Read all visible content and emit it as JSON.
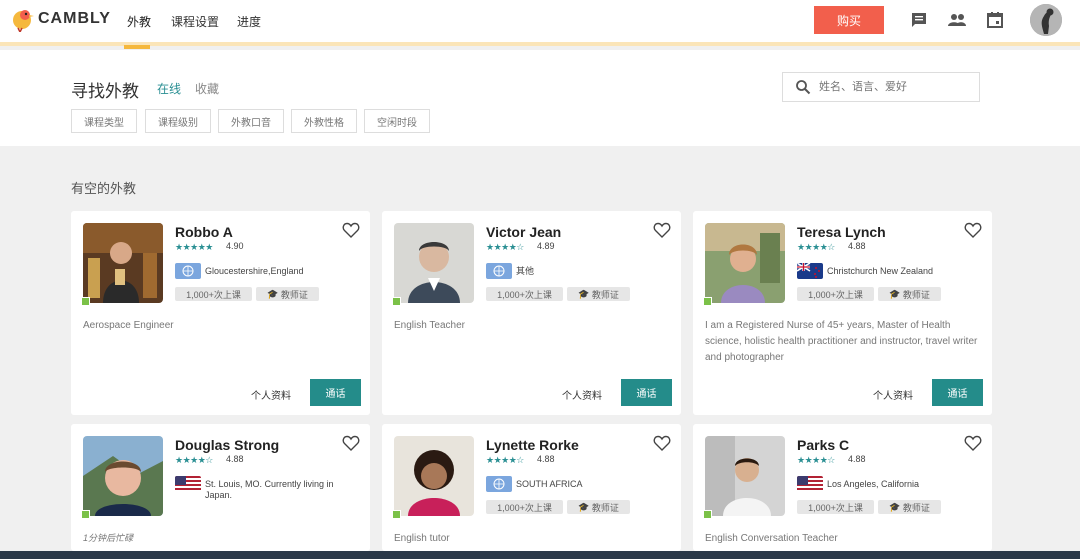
{
  "nav": {
    "brand": "CAMBLY",
    "links": [
      "外教",
      "课程设置",
      "进度"
    ],
    "buy_label": "购买"
  },
  "search": {
    "title": "寻找外教",
    "tab_online": "在线",
    "tab_favorites": "收藏",
    "placeholder": "姓名、语言、爱好",
    "filters": [
      "课程类型",
      "课程级别",
      "外教口音",
      "外教性格",
      "空闲时段"
    ]
  },
  "section_title": "有空的外教",
  "actions": {
    "profile": "个人资料",
    "call": "通话"
  },
  "badges": {
    "lessons": "1,000+次上课",
    "certified": "教师证"
  },
  "colors": {
    "accent": "#248c8a",
    "buy": "#f25f4c",
    "online": "#7bc148",
    "nav_underline": "#f5b83d"
  },
  "tutors": [
    {
      "name": "Robbo A",
      "stars": "★★★★★",
      "rating": "4.90",
      "flag": "un-flag",
      "location": "Gloucestershire,England",
      "bio": "Aerospace Engineer"
    },
    {
      "name": "Victor Jean",
      "stars": "★★★★☆",
      "rating": "4.89",
      "flag": "un-flag",
      "location": "其他",
      "bio": "English Teacher"
    },
    {
      "name": "Teresa Lynch",
      "stars": "★★★★☆",
      "rating": "4.88",
      "flag": "nz-flag",
      "location": "Christchurch New Zealand",
      "bio": "I am a Registered Nurse of 45+ years, Master of Health science, holistic health practitioner and instructor, travel writer and photographer"
    },
    {
      "name": "Douglas Strong",
      "stars": "★★★★☆",
      "rating": "4.88",
      "flag": "us-flag",
      "location": "St. Louis, MO. Currently living in Japan.",
      "bio": "1分钟后忙碌"
    },
    {
      "name": "Lynette Rorke",
      "stars": "★★★★☆",
      "rating": "4.88",
      "flag": "un-flag",
      "location": "SOUTH AFRICA",
      "bio": "English tutor"
    },
    {
      "name": "Parks C",
      "stars": "★★★★☆",
      "rating": "4.88",
      "flag": "us-flag",
      "location": "Los Angeles, California",
      "bio": "English Conversation Teacher"
    }
  ]
}
